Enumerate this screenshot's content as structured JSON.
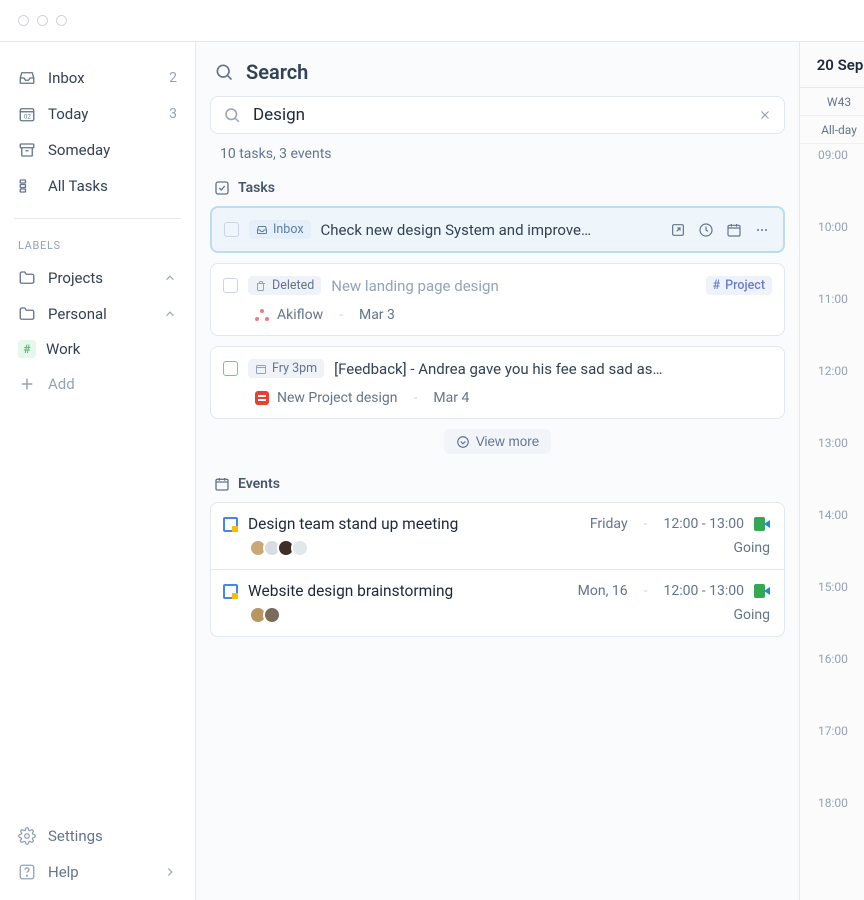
{
  "sidebar": {
    "inbox": {
      "label": "Inbox",
      "count": "2"
    },
    "today": {
      "label": "Today",
      "count": "3"
    },
    "someday": {
      "label": "Someday"
    },
    "alltasks": {
      "label": "All Tasks"
    },
    "labels_heading": "LABELS",
    "projects": {
      "label": "Projects"
    },
    "personal": {
      "label": "Personal"
    },
    "work": {
      "label": "Work",
      "chip": "#"
    },
    "add": {
      "label": "Add"
    },
    "settings": {
      "label": "Settings"
    },
    "help": {
      "label": "Help"
    }
  },
  "main": {
    "title": "Search",
    "searchValue": "Design",
    "resultsMeta": "10 tasks, 3 events",
    "tasksHeading": "Tasks",
    "eventsHeading": "Events",
    "viewMore": "View more"
  },
  "tasks": [
    {
      "chip": "Inbox",
      "title": "Check new design System and improve…"
    },
    {
      "chip": "Deleted",
      "title": "New landing page design",
      "projectChip": "Project",
      "source": "Akiflow",
      "date": "Mar 3"
    },
    {
      "chip": "Fry 3pm",
      "title": "[Feedback] - Andrea gave you his fee sad sad  as…",
      "source": "New Project design",
      "date": "Mar 4"
    }
  ],
  "events": [
    {
      "title": "Design team stand up meeting",
      "day": "Friday",
      "time": "12:00 - 13:00",
      "going": "Going",
      "avatars": [
        "#c9a876",
        "#d8dde3",
        "#3d2f25",
        "#e2e7ec"
      ]
    },
    {
      "title": "Website design brainstorming",
      "day": "Mon, 16",
      "time": "12:00 - 13:00",
      "going": "Going",
      "avatars": [
        "#b79660",
        "#7a6b5a"
      ]
    }
  ],
  "calendar": {
    "date": "20 Sep",
    "week": "W43",
    "allday": "All-day",
    "hours": [
      "09:00",
      "10:00",
      "11:00",
      "12:00",
      "13:00",
      "14:00",
      "15:00",
      "16:00",
      "17:00",
      "18:00"
    ]
  }
}
